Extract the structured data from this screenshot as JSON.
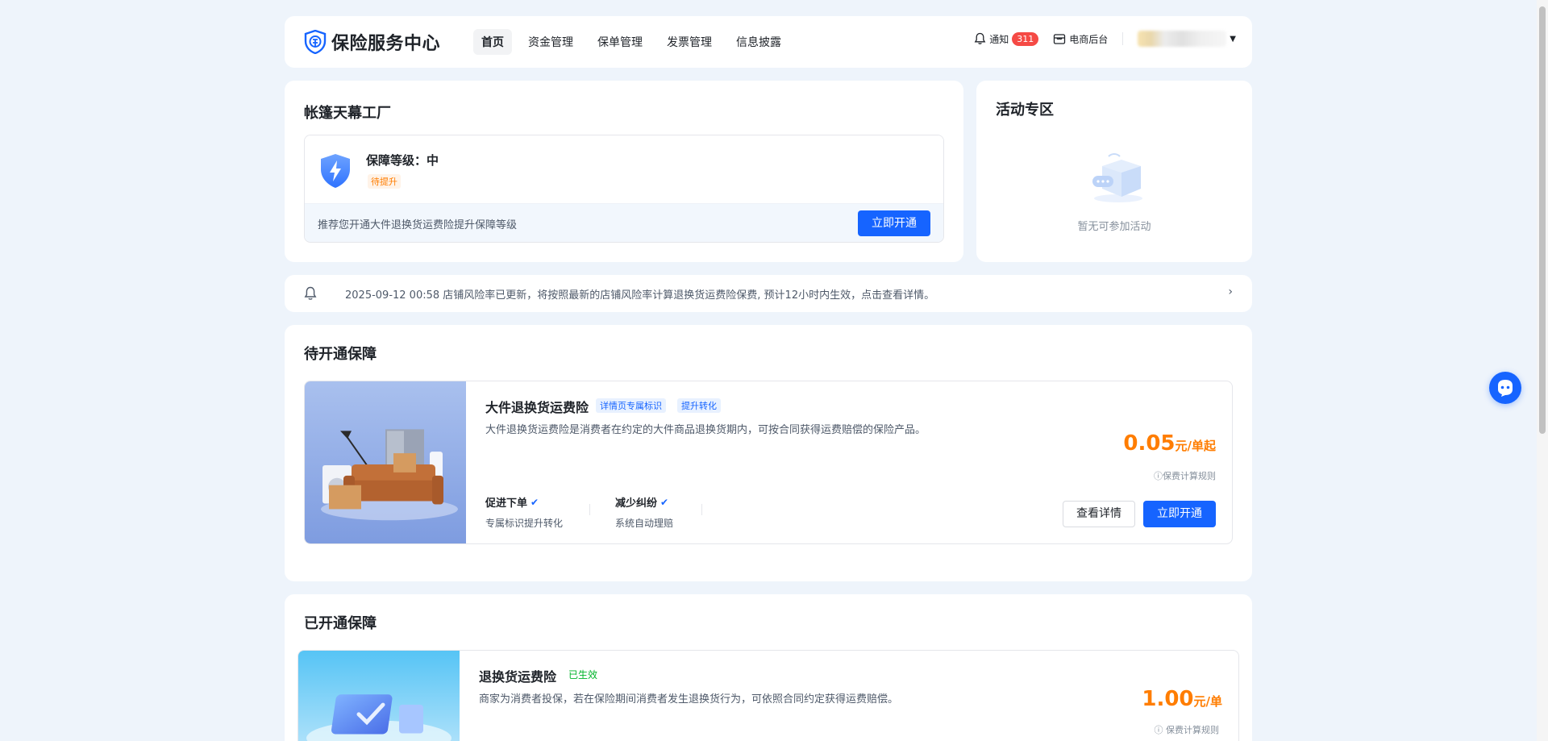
{
  "header": {
    "logo_text": "保险服务中心",
    "nav": [
      {
        "label": "首页",
        "active": true
      },
      {
        "label": "资金管理"
      },
      {
        "label": "保单管理"
      },
      {
        "label": "发票管理"
      },
      {
        "label": "信息披露"
      }
    ],
    "notify_label": "通知",
    "notify_count": "311",
    "ecom_label": "电商后台",
    "brand_color": "#1664ff"
  },
  "shop": {
    "name": "帐篷天幕工厂",
    "level_label": "保障等级：中",
    "level_status": "待提升",
    "tip": "推荐您开通大件退换货运费险提升保障等级",
    "open_button": "立即开通"
  },
  "activity": {
    "title": "活动专区",
    "empty_text": "暂无可参加活动"
  },
  "notice": {
    "text": "2025-09-12 00:58 店铺风险率已更新，将按照最新的店铺风险率计算退换货运费险保费, 预计12小时内生效，点击查看详情。"
  },
  "pending": {
    "title": "待开通保障",
    "product": {
      "name": "大件退换货运费险",
      "tags": [
        "详情页专属标识",
        "提升转化"
      ],
      "desc": "大件退换货运费险是消费者在约定的大件商品退换货期内，可按合同获得运费赔偿的保险产品。",
      "features": [
        {
          "title": "促进下单",
          "sub": "专属标识提升转化"
        },
        {
          "title": "减少纠纷",
          "sub": "系统自动理赔"
        }
      ],
      "price": "0.05",
      "price_unit": "元/单起",
      "price_rule": "保费计算规则",
      "detail_button": "查看详情",
      "open_button": "立即开通"
    }
  },
  "active": {
    "title": "已开通保障",
    "product": {
      "name": "退换货运费险",
      "status": "已生效",
      "desc": "商家为消费者投保，若在保险期间消费者发生退换货行为，可依照合同约定获得运费赔偿。",
      "price": "1.00",
      "price_unit": "元/单",
      "price_rule": "保费计算规则"
    }
  }
}
